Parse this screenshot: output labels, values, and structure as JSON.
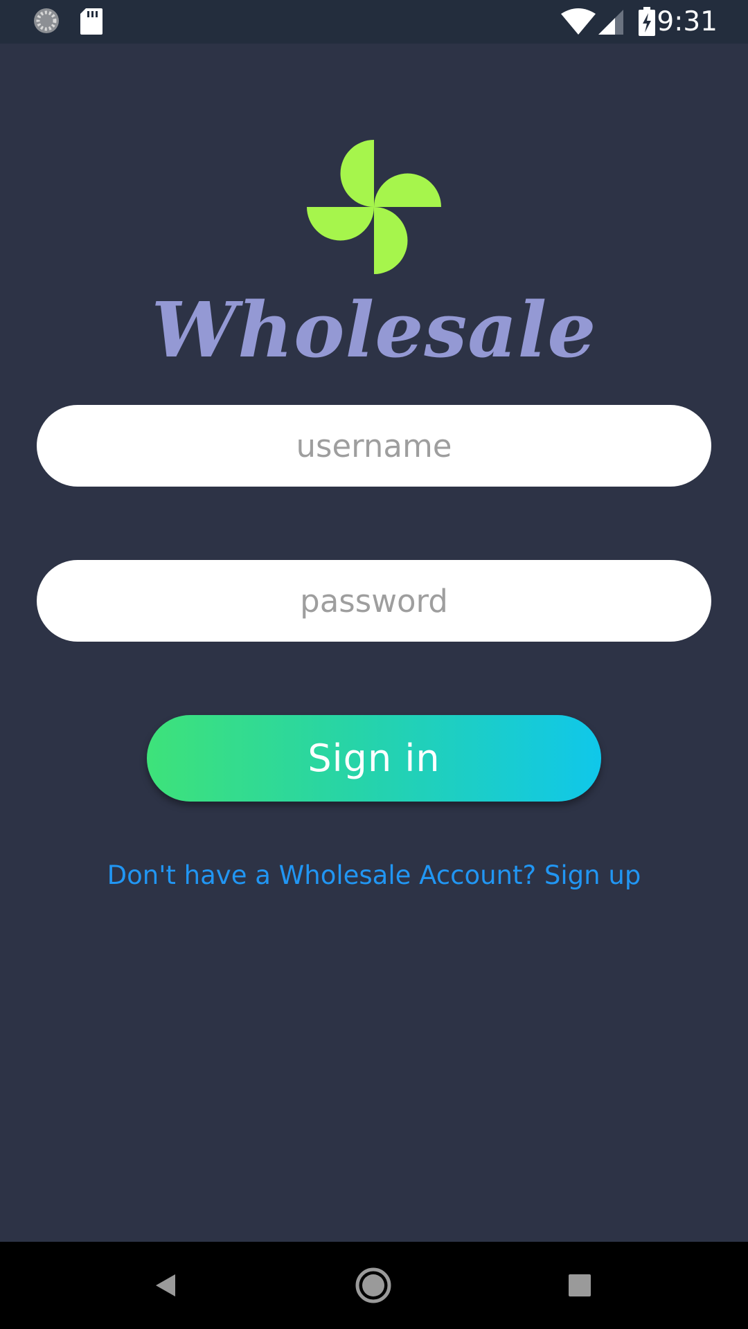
{
  "status_bar": {
    "time": "9:31",
    "icons": [
      "loading-icon",
      "sd-card-icon",
      "wifi-icon",
      "signal-icon",
      "battery-charging-icon"
    ]
  },
  "brand": {
    "name": "Wholesale",
    "logo_icon": "pinwheel-logo-icon",
    "logo_color": "#a6f54c",
    "name_color": "#9499d4"
  },
  "login": {
    "username_placeholder": "username",
    "password_placeholder": "password",
    "signin_label": "Sign in",
    "signup_text": "Don't have a Wholesale Account? Sign up"
  },
  "colors": {
    "background": "#2d3346",
    "status_bar": "#232d3d",
    "button_gradient_start": "#3ee27a",
    "button_gradient_end": "#10c7ea",
    "link": "#2196f3"
  },
  "nav_bar": {
    "buttons": [
      "back-icon",
      "home-icon",
      "recents-icon"
    ]
  }
}
